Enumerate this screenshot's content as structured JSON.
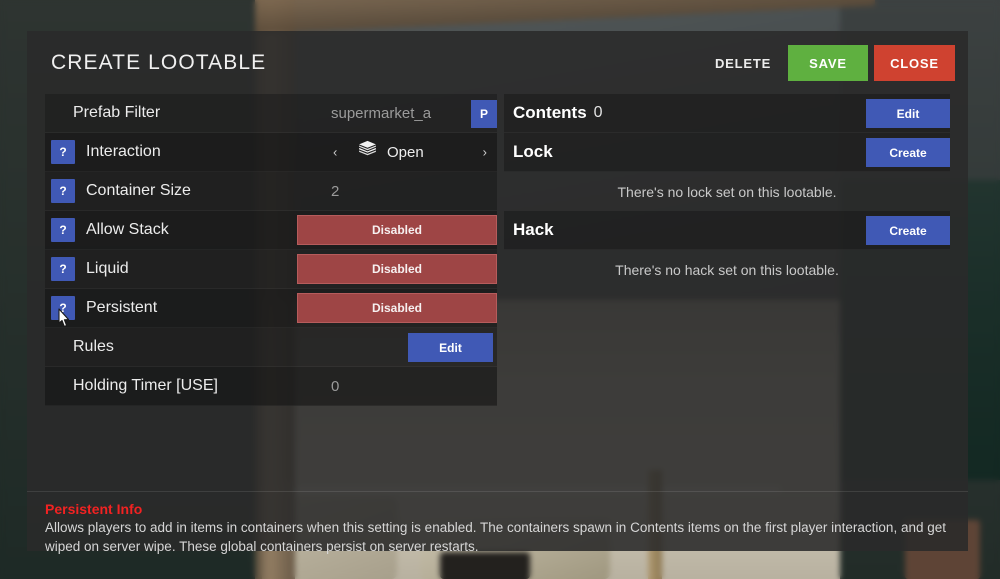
{
  "window": {
    "title": "CREATE LOOTABLE"
  },
  "header": {
    "buttons": [
      {
        "label": "DELETE",
        "name": "delete-button",
        "color": "transparent"
      },
      {
        "label": "SAVE",
        "name": "save-button",
        "color": "#5fb040"
      },
      {
        "label": "CLOSE",
        "name": "close-button",
        "color": "#cf4230"
      }
    ]
  },
  "left_column": {
    "prefab_filter": {
      "label": "Prefab Filter",
      "value": "supermarket_a",
      "pick_button": "P"
    },
    "interaction": {
      "help": "?",
      "label": "Interaction",
      "prev_arrow": "‹",
      "next_arrow": "›",
      "icon": "box-icon",
      "value": "Open"
    },
    "container_size": {
      "help": "?",
      "label": "Container Size",
      "value": "2"
    },
    "allow_stack": {
      "help": "?",
      "label": "Allow Stack",
      "state": "Disabled"
    },
    "liquid": {
      "help": "?",
      "label": "Liquid",
      "state": "Disabled"
    },
    "persistent": {
      "help": "?",
      "label": "Persistent",
      "state": "Disabled"
    },
    "rules": {
      "label": "Rules",
      "button": "Edit"
    },
    "holding_timer": {
      "label": "Holding Timer [USE]",
      "value": "0"
    }
  },
  "right_column": {
    "contents": {
      "label": "Contents",
      "count": "0",
      "button": "Edit"
    },
    "lock": {
      "label": "Lock",
      "button": "Create",
      "note": "There's no lock set on this lootable."
    },
    "hack": {
      "label": "Hack",
      "button": "Create",
      "note": "There's no hack set on this lootable."
    }
  },
  "info": {
    "title": "Persistent Info",
    "text": "Allows players to add in items in containers when this setting is enabled. The containers spawn in Contents items on the first player interaction, and get wiped on server wipe. These global containers persist on server restarts."
  },
  "colors": {
    "accent_blue": "#4059b5",
    "save_green": "#5fb040",
    "close_red": "#cf4230",
    "disabled_red": "#9e4545",
    "info_title_red": "#f22222"
  }
}
